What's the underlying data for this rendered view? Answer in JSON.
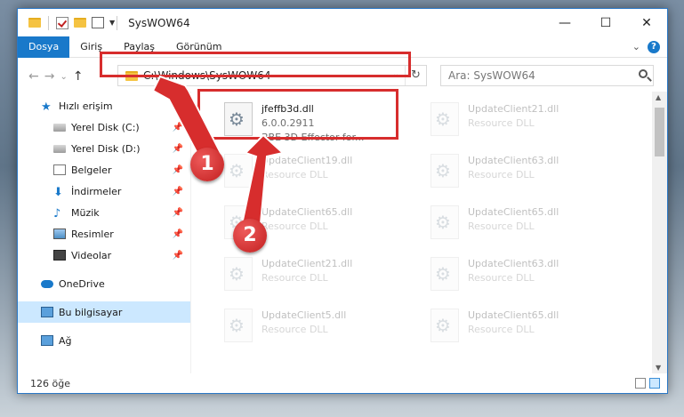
{
  "window": {
    "title": "SysWOW64",
    "controls": {
      "minimize": "—",
      "maximize": "☐",
      "close": "✕"
    }
  },
  "ribbon": {
    "tabs": [
      "Dosya",
      "Giriş",
      "Paylaş",
      "Görünüm"
    ],
    "active_tab": "Dosya",
    "help": "?",
    "expand": "⌄"
  },
  "address": {
    "path": "C:\\Windows\\SysWOW64",
    "refresh": "↻",
    "dropdown": "⌄"
  },
  "search": {
    "placeholder": "Ara: SysWOW64"
  },
  "nav": {
    "back": "←",
    "forward": "→",
    "recent": "⌄",
    "up": "↑"
  },
  "navpane": {
    "items": [
      {
        "label": "Hızlı erişim",
        "icon": "star-icon",
        "pinned": false
      },
      {
        "label": "Yerel Disk (C:)",
        "icon": "drive-icon",
        "pinned": true
      },
      {
        "label": "Yerel Disk (D:)",
        "icon": "drive-icon",
        "pinned": true
      },
      {
        "label": "Belgeler",
        "icon": "document-icon",
        "pinned": true
      },
      {
        "label": "İndirmeler",
        "icon": "download-icon",
        "pinned": true
      },
      {
        "label": "Müzik",
        "icon": "music-icon",
        "pinned": true
      },
      {
        "label": "Resimler",
        "icon": "pictures-icon",
        "pinned": true
      },
      {
        "label": "Videolar",
        "icon": "video-icon",
        "pinned": true
      },
      {
        "label": "OneDrive",
        "icon": "cloud-icon",
        "pinned": false
      },
      {
        "label": "Bu bilgisayar",
        "icon": "computer-icon",
        "pinned": false
      },
      {
        "label": "Ağ",
        "icon": "network-icon",
        "pinned": false
      }
    ],
    "selected": "Bu bilgisayar"
  },
  "files": [
    {
      "name": "jfeffb3d.dll",
      "line2": "6.0.0.2911",
      "line3": "BBE 3D Effector for...",
      "highlighted": true
    },
    {
      "name": "UpdateClient21.dll",
      "line2": "Resource DLL"
    },
    {
      "name": "UpdateClient19.dll",
      "line2": "Resource DLL"
    },
    {
      "name": "UpdateClient63.dll",
      "line2": "Resource DLL"
    },
    {
      "name": "UpdateClient65.dll",
      "line2": "Resource DLL"
    },
    {
      "name": "UpdateClient65.dll",
      "line2": "Resource DLL"
    },
    {
      "name": "UpdateClient21.dll",
      "line2": "Resource DLL"
    },
    {
      "name": "UpdateClient63.dll",
      "line2": "Resource DLL"
    },
    {
      "name": "UpdateClient5.dll",
      "line2": "Resource DLL"
    },
    {
      "name": "UpdateClient65.dll",
      "line2": "Resource DLL"
    }
  ],
  "status": {
    "count": "126 öğe"
  },
  "markers": [
    "1",
    "2"
  ],
  "colors": {
    "accent": "#1979ca",
    "highlight": "#d72d2d",
    "selected": "#cce8ff"
  }
}
